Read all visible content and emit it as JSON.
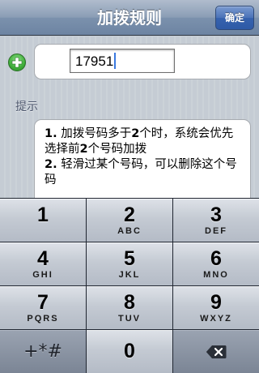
{
  "navbar": {
    "title": "加拨规则",
    "confirm_label": "确定"
  },
  "rule": {
    "value": "17951"
  },
  "hint": {
    "label": "提示",
    "lines": [
      {
        "num": "1.",
        "text": " 加拨号码多于",
        "num2": "2",
        "text2": "个时，系统会优先选择前",
        "num3": "2",
        "text3": "个号码加拨"
      },
      {
        "num": "2.",
        "text": " 轻滑过某个号码，可以删除这个号码"
      }
    ]
  },
  "keypad": {
    "keys": [
      {
        "digit": "1",
        "letters": ""
      },
      {
        "digit": "2",
        "letters": "ABC"
      },
      {
        "digit": "3",
        "letters": "DEF"
      },
      {
        "digit": "4",
        "letters": "GHI"
      },
      {
        "digit": "5",
        "letters": "JKL"
      },
      {
        "digit": "6",
        "letters": "MNO"
      },
      {
        "digit": "7",
        "letters": "PQRS"
      },
      {
        "digit": "8",
        "letters": "TUV"
      },
      {
        "digit": "9",
        "letters": "WXYZ"
      }
    ],
    "symbols_label": "+*#",
    "zero": "0",
    "delete_icon": "backspace-icon"
  },
  "icons": {
    "add": "plus-circle-icon"
  }
}
